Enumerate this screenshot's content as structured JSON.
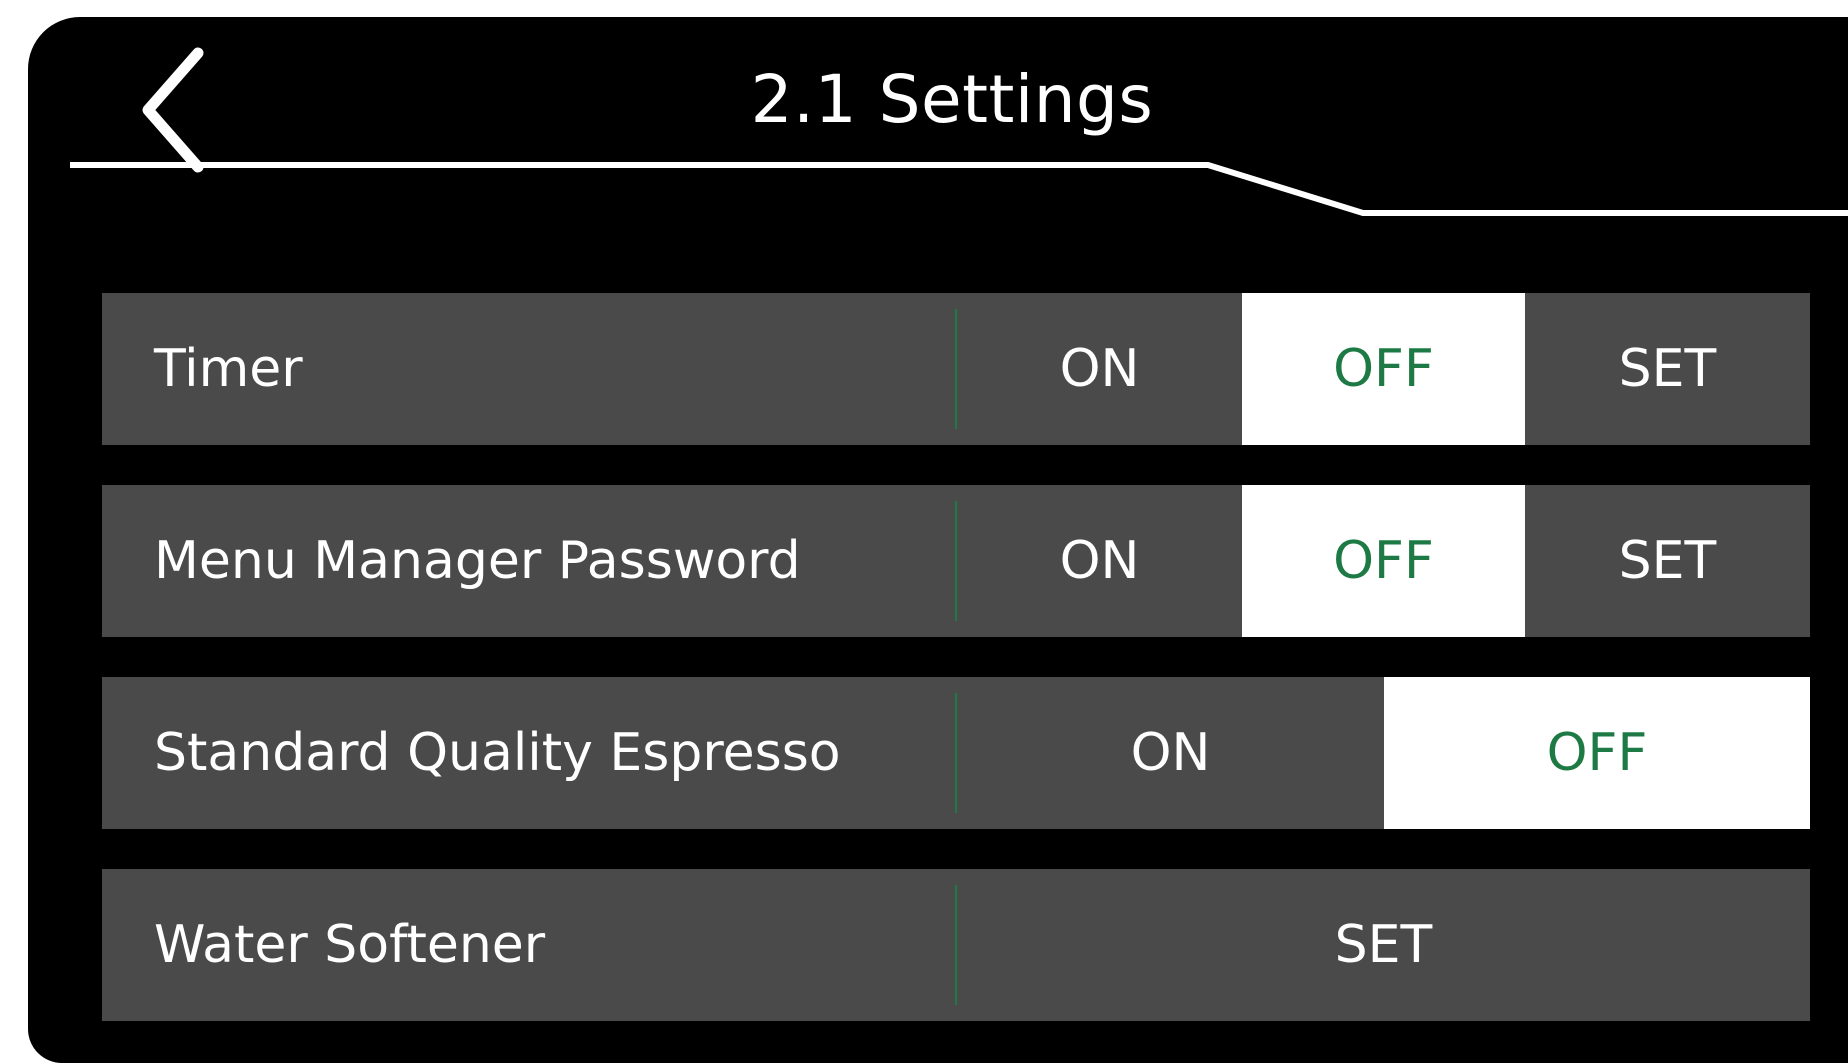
{
  "header": {
    "title": "2.1 Settings",
    "back_icon": "chevron-left-icon"
  },
  "settings": [
    {
      "label": "Timer",
      "on": "ON",
      "off": "OFF",
      "set": "SET",
      "selected": "OFF"
    },
    {
      "label": "Menu Manager Password",
      "on": "ON",
      "off": "OFF",
      "set": "SET",
      "selected": "OFF"
    },
    {
      "label": "Standard Quality Espresso",
      "on": "ON",
      "off": "OFF",
      "selected": "OFF"
    },
    {
      "label": "Water Softener",
      "set": "SET"
    }
  ],
  "colors": {
    "background": "#000000",
    "row": "#4a4a4a",
    "selected_bg": "#ffffff",
    "selected_text": "#1d7a44",
    "divider": "#1f7a4a"
  }
}
